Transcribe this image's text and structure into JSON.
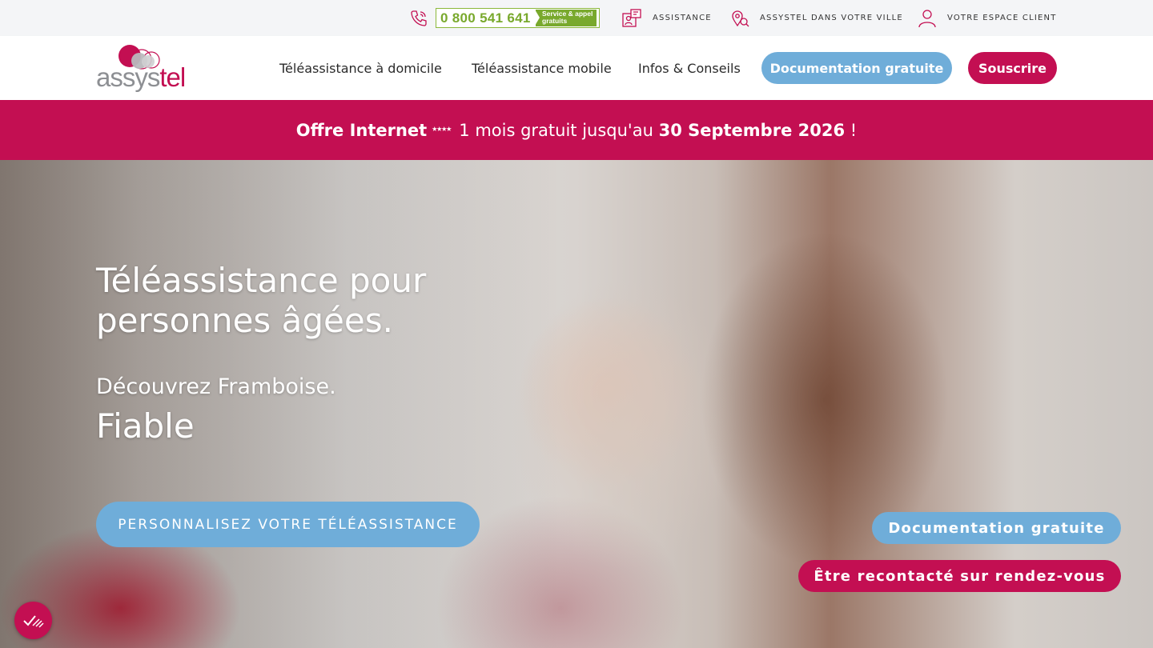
{
  "topbar": {
    "phone_number": "0 800 541 641",
    "phone_tag_line1": "Service & appel",
    "phone_tag_line2": "gratuits",
    "assistance_label": "ASSISTANCE",
    "city_label": "ASSYSTEL DANS VOTRE VILLE",
    "client_label": "VOTRE ESPACE CLIENT",
    "icons": [
      "phone-icon",
      "assistance-icon",
      "location-icon",
      "user-icon"
    ]
  },
  "header": {
    "logo_part1": "assys",
    "logo_part2": "tel",
    "nav": [
      "Téléassistance à domicile",
      "Téléassistance mobile",
      "Infos & Conseils"
    ],
    "doc_button": "Documentation gratuite",
    "subscribe_button": "Souscrire"
  },
  "promo": {
    "strong_prefix": "Offre Internet",
    "stars": "⭑⭑⭑⭑",
    "middle": "1 mois gratuit jusqu'au",
    "strong_date": "30 Septembre 2026",
    "suffix": "!"
  },
  "hero": {
    "title_line1": "Téléassistance pour",
    "title_line2": "personnes âgées.",
    "subtitle": "Découvrez Framboise.",
    "rotating_word": "Fiable",
    "cta_main": "PERSONNALISEZ VOTRE TÉLÉASSISTANCE",
    "cta_doc": "Documentation gratuite",
    "cta_callback": "Être recontacté sur rendez-vous"
  },
  "colors": {
    "brand_pink": "#c30f52",
    "brand_blue": "#6fadd9",
    "brand_grey": "#8d8f93",
    "phone_green": "#79a92d"
  }
}
